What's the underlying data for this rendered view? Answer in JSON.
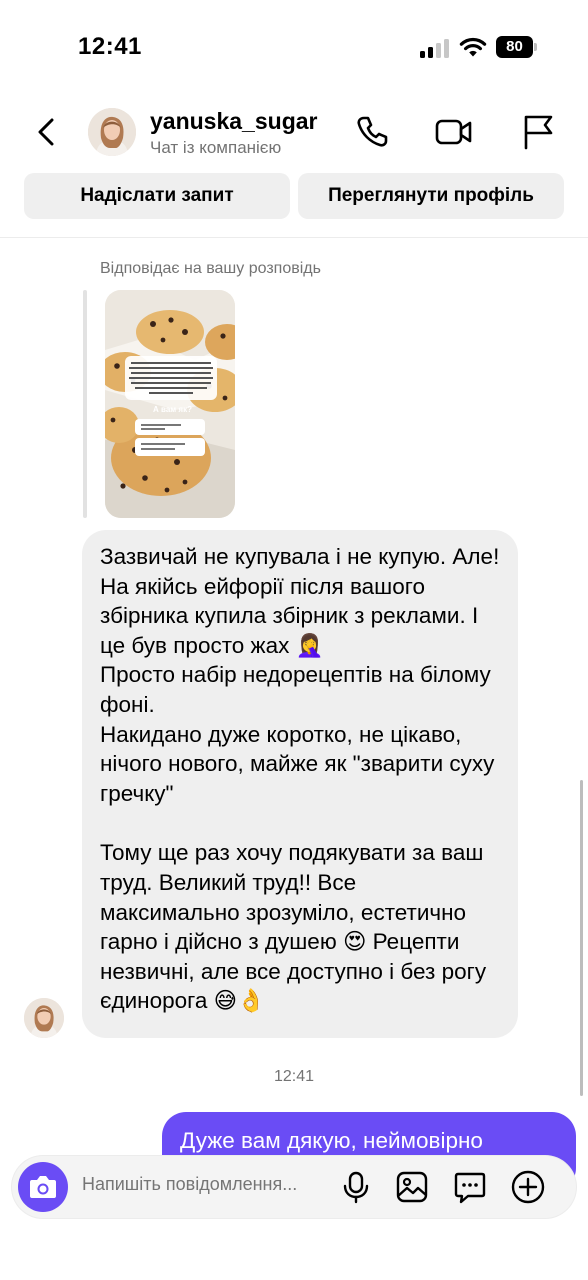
{
  "status_bar": {
    "time": "12:41",
    "battery": "80"
  },
  "header": {
    "username": "yanuska_sugar",
    "subtitle": "Чат із компанією",
    "icons": [
      "back-chevron-icon",
      "phone-icon",
      "video-camera-icon",
      "flag-icon"
    ]
  },
  "actions": {
    "send_request": "Надіслати запит",
    "view_profile": "Переглянути профіль"
  },
  "reply": {
    "label": "Відповідає на вашу розповідь",
    "story": {
      "text": "Діяться, хто мені вежливо, коли я щось купую через рекламу в інстаграм, переходячи на сторінку людини і бачачи те воно, чим займається, і не я можу зрозуміти що воно нишком безкоштовно, щоб потім придбати її платний продукт",
      "question": "А вам як?",
      "option_1": "Не купую не побачив сторінку",
      "option_2": "Та все одно, головне інформ. на сайті"
    }
  },
  "messages": {
    "incoming": {
      "p1": "Зазвичай не купувала і не купую. Але! На якійсь ейфорії після вашого збірника купила збірник з реклами. І це був просто жах 🤦‍♀️",
      "p2": "Просто набір недорецептів на білому фоні.",
      "p3": "Накидано дуже коротко, не цікаво, нічого нового, майже як \"зварити суху гречку\"",
      "p4": "Тому ще раз хочу подякувати за ваш труд. Великий труд!! Все максимально зрозуміло, естетично гарно і дійсно з душею 😍 Рецепти незвичні, але все доступно і без рогу єдинорога 😅👌"
    },
    "timestamp": "12:41",
    "outgoing": "Дуже вам дякую, неймовірно"
  },
  "composer": {
    "placeholder": "Напишіть повідомлення...",
    "icons": [
      "camera-icon",
      "microphone-icon",
      "gallery-icon",
      "sticker-icon",
      "plus-icon"
    ]
  },
  "colors": {
    "accent": "#6a4cf5",
    "bubble_incoming": "#efefef",
    "secondary_text": "#737373"
  }
}
